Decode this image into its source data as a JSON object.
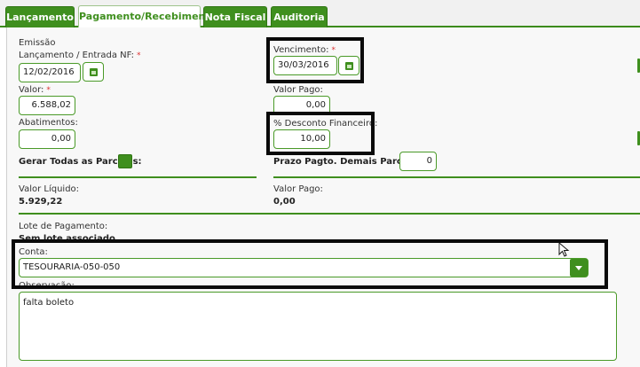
{
  "tabs": [
    {
      "label": "Lançamento",
      "active": false
    },
    {
      "label": "Pagamento/Recebimento",
      "active": true
    },
    {
      "label": "Nota Fiscal",
      "active": false
    },
    {
      "label": "Auditoria",
      "active": false
    }
  ],
  "form": {
    "emissao_label": "Emissão",
    "lancamento_label": "Lançamento / Entrada NF:",
    "lancamento_value": "12/02/2016",
    "vencimento_label": "Vencimento:",
    "vencimento_value": "30/03/2016",
    "valor_label": "Valor:",
    "valor_value": "6.588,02",
    "valor_pago_label": "Valor Pago:",
    "valor_pago_value": "0,00",
    "abatimentos_label": "Abatimentos:",
    "abatimentos_value": "0,00",
    "desconto_label": "% Desconto Financeiro:",
    "desconto_value": "10,00",
    "gerar_parcelas_label": "Gerar Todas as Parcelas:",
    "prazo_label": "Prazo Pagto. Demais Parcelas:",
    "prazo_value": "0",
    "required_mark": "*"
  },
  "summary": {
    "valor_liquido_label": "Valor Líquido:",
    "valor_liquido_value": "5.929,22",
    "valor_pago_label": "Valor Pago:",
    "valor_pago_value": "0,00"
  },
  "lote": {
    "label": "Lote de Pagamento:",
    "value": "Sem lote associado."
  },
  "conta": {
    "label": "Conta:",
    "selected": "TESOURARIA-050-050"
  },
  "observacao": {
    "label": "Observação:",
    "value": "falta boleto"
  },
  "colors": {
    "accent": "#3f8f1e",
    "highlight_border": "#0a0a0a",
    "required": "#dd3333"
  }
}
